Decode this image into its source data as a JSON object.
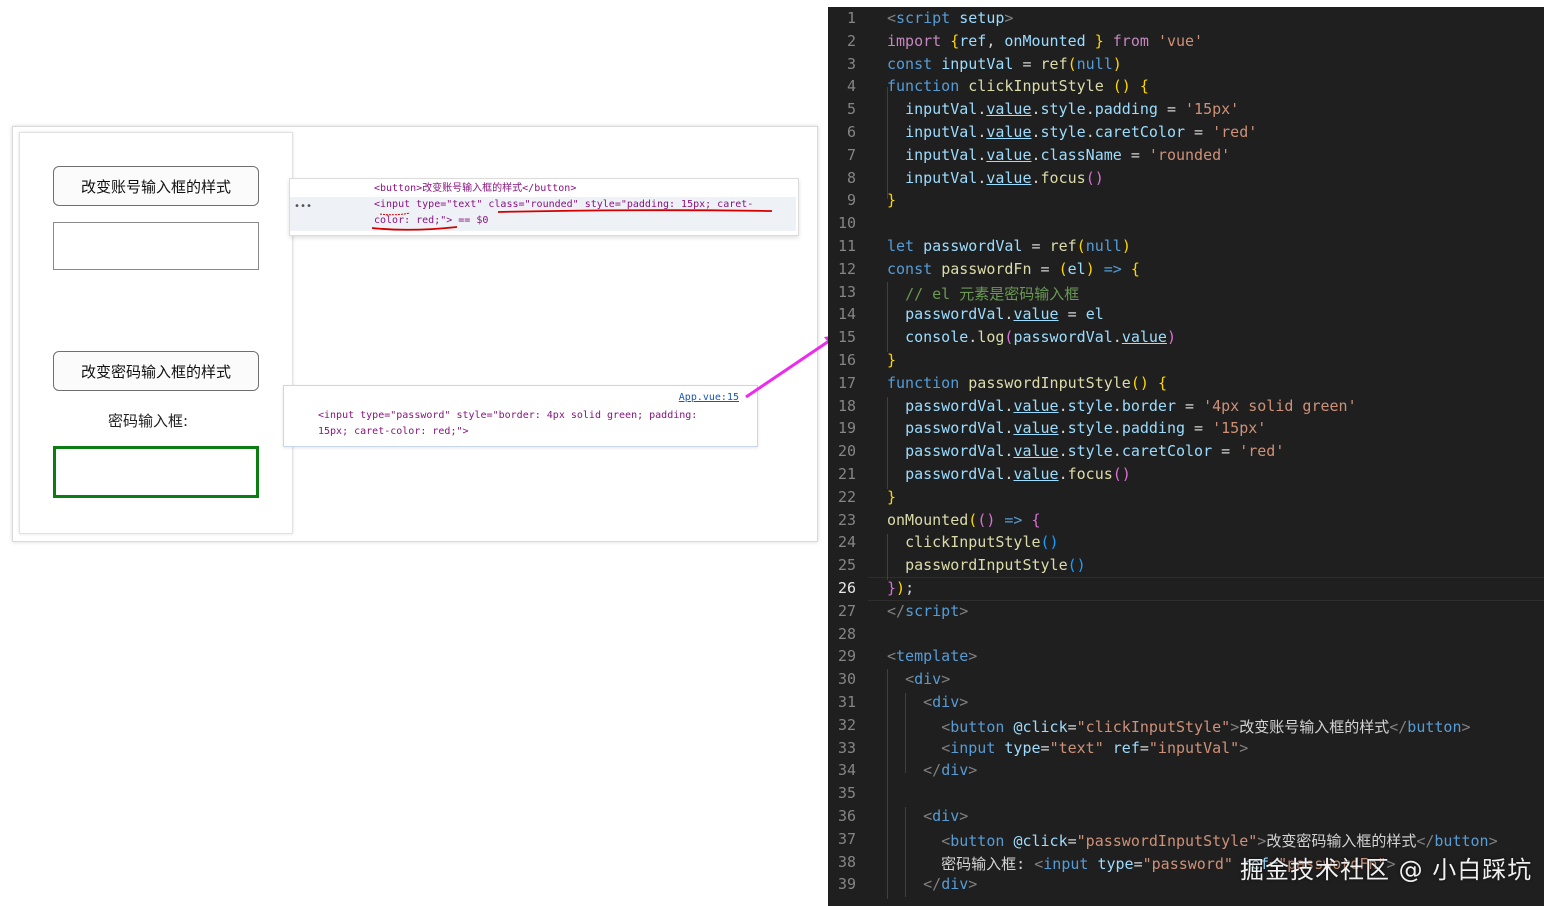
{
  "browser": {
    "change_account_btn": "改变账号输入框的样式",
    "change_password_btn": "改变密码输入框的样式",
    "password_label": "密码输入框:"
  },
  "devtools1": {
    "line1": "<button>改变账号输入框的样式</button>",
    "line2": "<input type=\"text\" class=\"rounded\" style=\"padding: 15px; caret-",
    "line3": "color: red;\"> == $0",
    "dots": "•••"
  },
  "devtools2": {
    "source_link": "App.vue:15",
    "line1": "<input type=\"password\" style=\"border: 4px solid green; padding:",
    "line2": "15px; caret-color: red;\">"
  },
  "editor": {
    "active_line": 26,
    "line_numbers": [
      "1",
      "2",
      "3",
      "4",
      "5",
      "6",
      "7",
      "8",
      "9",
      "10",
      "11",
      "12",
      "13",
      "14",
      "15",
      "16",
      "17",
      "18",
      "19",
      "20",
      "21",
      "22",
      "23",
      "24",
      "25",
      "26",
      "27",
      "28",
      "29",
      "30",
      "31",
      "32",
      "33",
      "34",
      "35",
      "36",
      "37",
      "38",
      "39"
    ]
  },
  "watermark": "掘金技术社区 @ 小白踩坑",
  "colors": {
    "editor_bg": "#1f1f1f",
    "arrow": "#ee2aee",
    "green_border": "#0c7d12",
    "underline_red": "#d40000"
  }
}
